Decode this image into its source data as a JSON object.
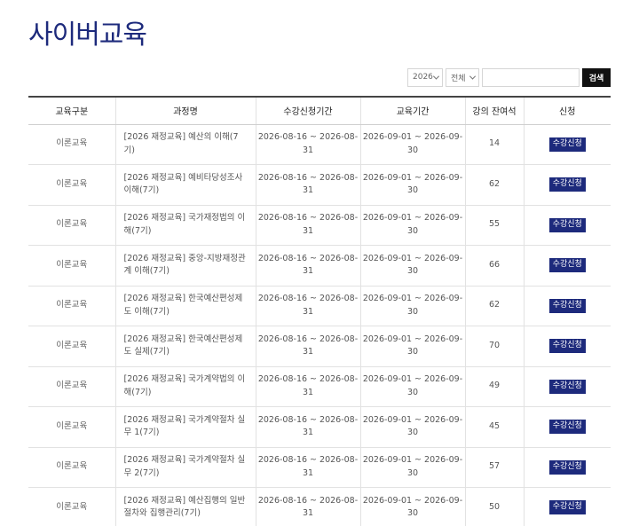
{
  "page": {
    "title": "사이버교육"
  },
  "search": {
    "year": "2026",
    "type": "전체",
    "query": "",
    "button_label": "검색"
  },
  "table": {
    "headers": [
      "교육구분",
      "과정명",
      "수강신청기간",
      "교육기간",
      "강의 잔여석",
      "신청"
    ],
    "rows": [
      {
        "category": "이론교육",
        "name": "[2026 재정교육] 예산의 이해(7기)",
        "apply_period": "2026-08-16 ~ 2026-08-31",
        "edu_period": "2026-09-01 ~ 2026-09-30",
        "seats": "14",
        "action": "수강신청"
      },
      {
        "category": "이론교육",
        "name": "[2026 재정교육] 예비타당성조사 이해(7기)",
        "apply_period": "2026-08-16 ~ 2026-08-31",
        "edu_period": "2026-09-01 ~ 2026-09-30",
        "seats": "62",
        "action": "수강신청"
      },
      {
        "category": "이론교육",
        "name": "[2026 재정교육] 국가재정법의 이해(7기)",
        "apply_period": "2026-08-16 ~ 2026-08-31",
        "edu_period": "2026-09-01 ~ 2026-09-30",
        "seats": "55",
        "action": "수강신청"
      },
      {
        "category": "이론교육",
        "name": "[2026 재정교육] 중앙-지방재정관계 이해(7기)",
        "apply_period": "2026-08-16 ~ 2026-08-31",
        "edu_period": "2026-09-01 ~ 2026-09-30",
        "seats": "66",
        "action": "수강신청"
      },
      {
        "category": "이론교육",
        "name": "[2026 재정교육] 한국예산편성제도 이해(7기)",
        "apply_period": "2026-08-16 ~ 2026-08-31",
        "edu_period": "2026-09-01 ~ 2026-09-30",
        "seats": "62",
        "action": "수강신청"
      },
      {
        "category": "이론교육",
        "name": "[2026 재정교육] 한국예산편성제도 실제(7기)",
        "apply_period": "2026-08-16 ~ 2026-08-31",
        "edu_period": "2026-09-01 ~ 2026-09-30",
        "seats": "70",
        "action": "수강신청"
      },
      {
        "category": "이론교육",
        "name": "[2026 재정교육] 국가계약법의 이해(7기)",
        "apply_period": "2026-08-16 ~ 2026-08-31",
        "edu_period": "2026-09-01 ~ 2026-09-30",
        "seats": "49",
        "action": "수강신청"
      },
      {
        "category": "이론교육",
        "name": "[2026 재정교육] 국가계약절차 실무 1(7기)",
        "apply_period": "2026-08-16 ~ 2026-08-31",
        "edu_period": "2026-09-01 ~ 2026-09-30",
        "seats": "45",
        "action": "수강신청"
      },
      {
        "category": "이론교육",
        "name": "[2026 재정교육] 국가계약절차 실무 2(7기)",
        "apply_period": "2026-08-16 ~ 2026-08-31",
        "edu_period": "2026-09-01 ~ 2026-09-30",
        "seats": "57",
        "action": "수강신청"
      },
      {
        "category": "이론교육",
        "name": "[2026 재정교육] 예산집행의 일반절차와 집행관리(7기)",
        "apply_period": "2026-08-16 ~ 2026-08-31",
        "edu_period": "2026-09-01 ~ 2026-09-30",
        "seats": "50",
        "action": "수강신청"
      }
    ]
  },
  "colors": {
    "accent": "#1d2a7c",
    "search_button": "#111111"
  },
  "icons": {
    "select_arrow": "chevron-down-icon"
  }
}
